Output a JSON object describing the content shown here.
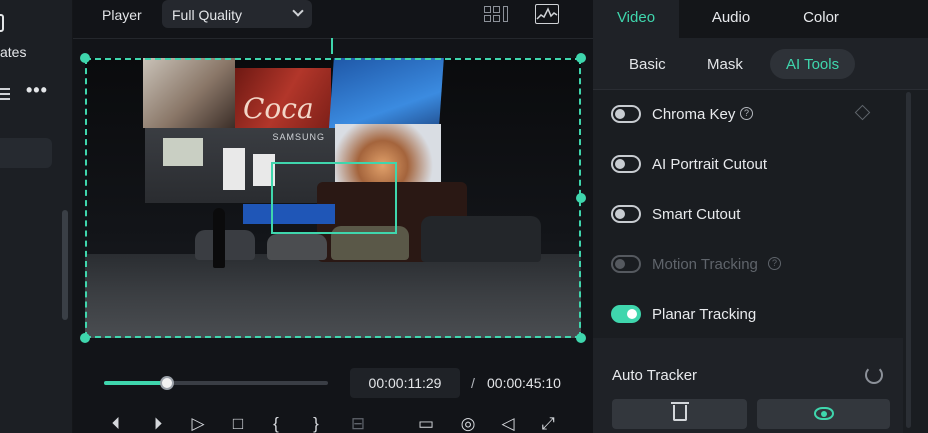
{
  "left_panel": {
    "label": "ates",
    "more": "•••"
  },
  "player": {
    "label": "Player",
    "quality": "Full Quality",
    "current_time": "00:00:11:29",
    "separator": "/",
    "total_time": "00:00:45:10",
    "progress_percent": 0.28,
    "billboard_text": "Coca",
    "samsung_text": "SAMSUNG"
  },
  "tabs": [
    "Video",
    "Audio",
    "Color"
  ],
  "active_tab": "Video",
  "subtabs": [
    "Basic",
    "Mask",
    "AI Tools"
  ],
  "active_subtab": "AI Tools",
  "ai_tools": [
    {
      "label": "Chroma Key",
      "enabled": false,
      "disabled": false,
      "help": "?"
    },
    {
      "label": "AI Portrait Cutout",
      "enabled": false,
      "disabled": false
    },
    {
      "label": "Smart Cutout",
      "enabled": false,
      "disabled": false
    },
    {
      "label": "Motion Tracking",
      "enabled": false,
      "disabled": true,
      "help": "?"
    },
    {
      "label": "Planar Tracking",
      "enabled": true,
      "disabled": false
    }
  ],
  "auto_tracker": {
    "label": "Auto Tracker"
  },
  "colors": {
    "accent": "#3fd6ad",
    "background": "#141619",
    "panel": "#1f2227"
  }
}
